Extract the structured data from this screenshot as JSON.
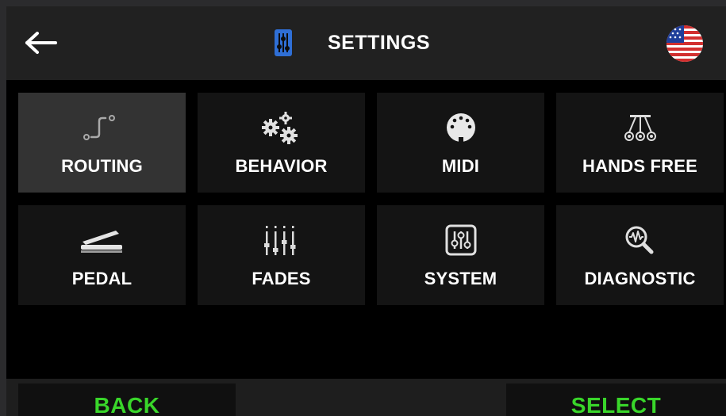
{
  "header": {
    "title": "SETTINGS",
    "back_icon": "arrow-left-icon",
    "title_icon": "sliders-icon",
    "language_icon": "us-flag-icon"
  },
  "tiles": [
    {
      "label": "ROUTING",
      "icon": "routing-icon",
      "selected": true
    },
    {
      "label": "BEHAVIOR",
      "icon": "gears-icon",
      "selected": false
    },
    {
      "label": "MIDI",
      "icon": "midi-connector-icon",
      "selected": false
    },
    {
      "label": "HANDS FREE",
      "icon": "footswitch-icon",
      "selected": false
    },
    {
      "label": "PEDAL",
      "icon": "expression-pedal-icon",
      "selected": false
    },
    {
      "label": "FADES",
      "icon": "faders-icon",
      "selected": false
    },
    {
      "label": "SYSTEM",
      "icon": "sliders-icon",
      "selected": false
    },
    {
      "label": "DIAGNOSTIC",
      "icon": "waveform-magnifier-icon",
      "selected": false
    }
  ],
  "footer": {
    "back_label": "BACK",
    "select_label": "SELECT"
  },
  "colors": {
    "accent_green": "#39d62a",
    "title_icon_blue": "#2f6fd6",
    "selected_tile": "#333333",
    "tile": "#141414"
  }
}
